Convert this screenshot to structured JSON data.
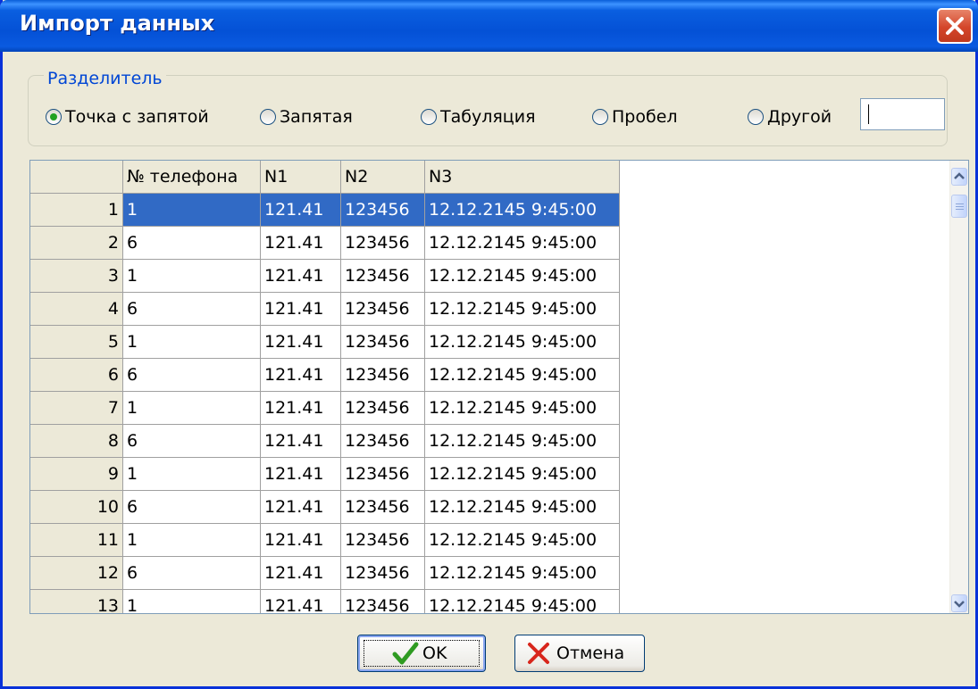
{
  "window": {
    "title": "Импорт данных"
  },
  "separator": {
    "legend": "Разделитель",
    "options": [
      {
        "label": "Точка с запятой",
        "selected": true
      },
      {
        "label": "Запятая",
        "selected": false
      },
      {
        "label": "Табуляция",
        "selected": false
      },
      {
        "label": "Пробел",
        "selected": false
      },
      {
        "label": "Другой",
        "selected": false
      }
    ],
    "other_value": ""
  },
  "table": {
    "columns": [
      "№ телефона",
      "N1",
      "N2",
      "N3"
    ],
    "rows": [
      {
        "num": "1",
        "cells": [
          "1",
          "121.41",
          "123456",
          "12.12.2145 9:45:00"
        ]
      },
      {
        "num": "2",
        "cells": [
          "6",
          "121.41",
          "123456",
          "12.12.2145 9:45:00"
        ]
      },
      {
        "num": "3",
        "cells": [
          "1",
          "121.41",
          "123456",
          "12.12.2145 9:45:00"
        ]
      },
      {
        "num": "4",
        "cells": [
          "6",
          "121.41",
          "123456",
          "12.12.2145 9:45:00"
        ]
      },
      {
        "num": "5",
        "cells": [
          "1",
          "121.41",
          "123456",
          "12.12.2145 9:45:00"
        ]
      },
      {
        "num": "6",
        "cells": [
          "6",
          "121.41",
          "123456",
          "12.12.2145 9:45:00"
        ]
      },
      {
        "num": "7",
        "cells": [
          "1",
          "121.41",
          "123456",
          "12.12.2145 9:45:00"
        ]
      },
      {
        "num": "8",
        "cells": [
          "6",
          "121.41",
          "123456",
          "12.12.2145 9:45:00"
        ]
      },
      {
        "num": "9",
        "cells": [
          "1",
          "121.41",
          "123456",
          "12.12.2145 9:45:00"
        ]
      },
      {
        "num": "10",
        "cells": [
          "6",
          "121.41",
          "123456",
          "12.12.2145 9:45:00"
        ]
      },
      {
        "num": "11",
        "cells": [
          "1",
          "121.41",
          "123456",
          "12.12.2145 9:45:00"
        ]
      },
      {
        "num": "12",
        "cells": [
          "6",
          "121.41",
          "123456",
          "12.12.2145 9:45:00"
        ]
      },
      {
        "num": "13",
        "cells": [
          "1",
          "121.41",
          "123456",
          "12.12.2145 9:45:00"
        ]
      }
    ],
    "selected_row": 0
  },
  "buttons": {
    "ok": "OK",
    "cancel": "Отмена"
  },
  "colors": {
    "selection": "#316ac5",
    "accent": "#0046d5"
  }
}
